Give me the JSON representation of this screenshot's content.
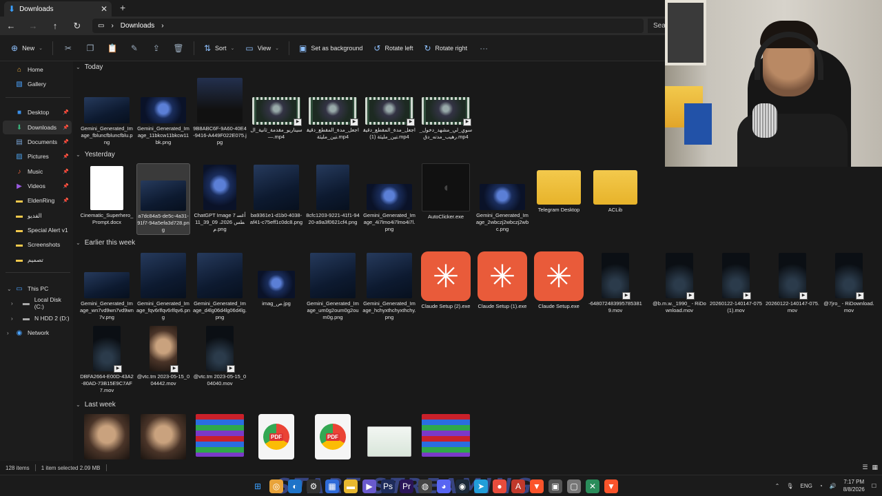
{
  "tab": {
    "title": "Downloads"
  },
  "address": {
    "crumb": "Downloads",
    "search_placeholder": "Sea"
  },
  "toolbar": {
    "new": "New",
    "sort": "Sort",
    "view": "View",
    "set_bg": "Set as background",
    "rotate_left": "Rotate left",
    "rotate_right": "Rotate right"
  },
  "sidebar": {
    "home": "Home",
    "gallery": "Gallery",
    "desktop": "Desktop",
    "downloads": "Downloads",
    "documents": "Documents",
    "pictures": "Pictures",
    "music": "Music",
    "videos": "Videos",
    "eldenring": "EldenRing",
    "f1": "الفديو",
    "special": "Special Alert v1",
    "screenshots": "Screenshots",
    "f2": "تصميم",
    "thispc": "This PC",
    "localc": "Local Disk (C:)",
    "hddd": "N HDD 2 (D:)",
    "network": "Network"
  },
  "groups": {
    "today": "Today",
    "yesterday": "Yesterday",
    "earlier": "Earlier this week",
    "lastweek": "Last week"
  },
  "files": {
    "today": [
      "Gemini_Generated_Image_fbluncfbluncfblu.png",
      "Gemini_Generated_Image_11bkcw11bkcw11bk.png",
      "9B8ABC6F-9A60-40E4-9416-A449F022E075.jpg",
      "سيناريو_مقدمة_ثانية_ال—.mp4",
      "اجعل_مدة_المقطع_دقيقتين_مليئة.mp4",
      "اجعل_مدة_المقطع_دقيقتين_مليئة (1).mp4",
      "سوي_لي_مشهد_دخول_رهيب_مدته_دق.mp4"
    ],
    "yesterday": [
      "Cinematic_Superhero_Prompt.docx",
      "a7dc84a5-de5c-4a31-91f7-94a5efa3d728.png",
      "ChatGPT Image 7 أغسطس 2026، 09_39_11 م.png",
      "ba9361e1-d1b0-4038-af41-c75eff1c0dc8.png",
      "8cfc1203-9221-41f1-9420-a9a3f0621cf4.png",
      "Gemini_Generated_Image_4i7lmo4i7lmo4i7l.png",
      "AutoClicker.exe",
      "Gemini_Generated_Image_2wbczj2wbczj2wbc.png",
      "Telegram Desktop",
      "ACLib"
    ],
    "earlier": [
      "Gemini_Generated_Image_wn7vd9wn7vd9wn7v.png",
      "Gemini_Generated_Image_fqv6rlfqv6rlfqv6.png",
      "Gemini_Generated_Image_d4lg06d4lg06d4lg.png",
      "imag_ص.jpg",
      "Gemini_Generated_Image_um0g2oum0g2oum0g.png",
      "Gemini_Generated_Image_hchyxthchyxthchy.png",
      "Claude Setup (2).exe",
      "Claude Setup (1).exe",
      "Claude Setup.exe",
      "-6480724839957853819.mov",
      "@b.m.w._1990_ - RiDownload.mov",
      "20260122-140147-075 (1).mov",
      "20260122-140147-075.mov",
      "@7jro_ - RiDownload.mov",
      "DBFA2664-E00D-43A2-80AD-73B15E9C7AF7.mov",
      "@vtc.tm 2023-05-15_004442.mov",
      "@vtc.tm 2023-05-15_004040.mov"
    ]
  },
  "status": {
    "items": "128 items",
    "selected": "1 item selected  2.09 MB"
  },
  "tray": {
    "lang": "ENG",
    "time": "7:17 PM",
    "date": "8/8/2026"
  },
  "taskbar_banner": "START STREAMING",
  "colors": {
    "accent": "#3aa0ff",
    "claude": "#e95b3a",
    "folder": "#f3c94c"
  }
}
